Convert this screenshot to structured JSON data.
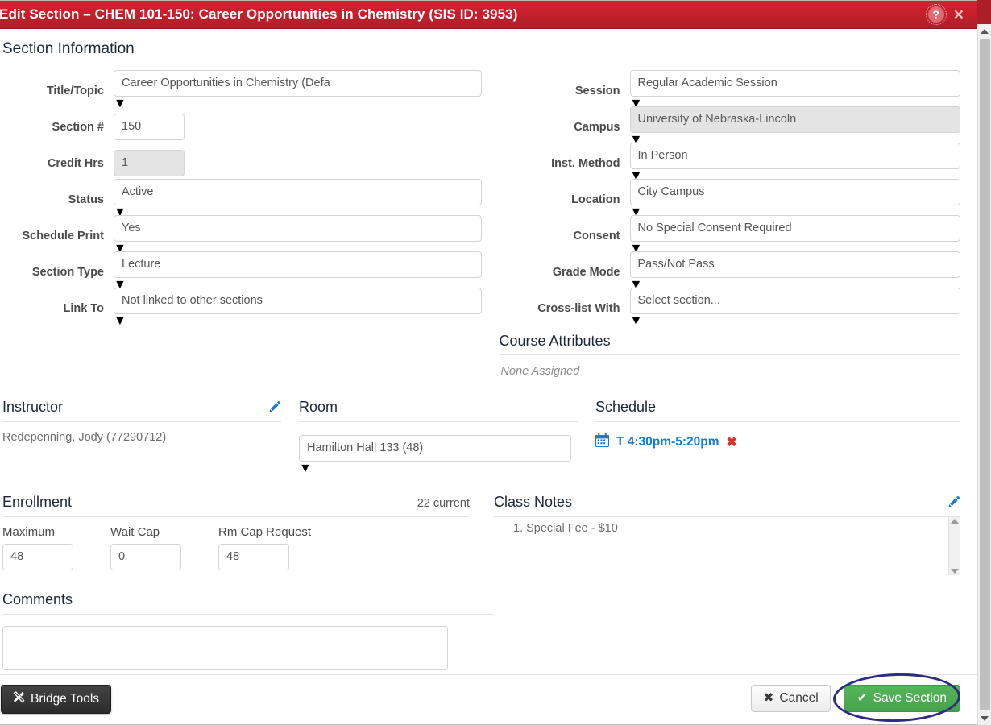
{
  "window": {
    "title": "Edit Section – CHEM 101-150: Career Opportunities in Chemistry (SIS ID: 3953)",
    "help_icon": "question-circle-icon",
    "close_icon": "×",
    "header_color": "#c9202c"
  },
  "section_information": {
    "heading": "Section Information",
    "left_fields": [
      {
        "label": "Title/Topic",
        "value": "Career Opportunities in Chemistry (Defa",
        "type": "select",
        "disabled": false
      },
      {
        "label": "Section #",
        "value": "150",
        "type": "text",
        "disabled": false
      },
      {
        "label": "Credit Hrs",
        "value": "1",
        "type": "text",
        "disabled": true
      },
      {
        "label": "Status",
        "value": "Active",
        "type": "select",
        "disabled": false
      },
      {
        "label": "Schedule Print",
        "value": "Yes",
        "type": "select",
        "disabled": false
      },
      {
        "label": "Section Type",
        "value": "Lecture",
        "type": "select",
        "disabled": false
      },
      {
        "label": "Link To",
        "value": "Not linked to other sections",
        "type": "select",
        "disabled": false
      }
    ],
    "right_fields": [
      {
        "label": "Session",
        "value": "Regular Academic Session",
        "type": "select",
        "disabled": false
      },
      {
        "label": "Campus",
        "value": "University of Nebraska-Lincoln",
        "type": "select",
        "disabled": true
      },
      {
        "label": "Inst. Method",
        "value": "In Person",
        "type": "select",
        "disabled": false
      },
      {
        "label": "Location",
        "value": "City Campus",
        "type": "select",
        "disabled": false
      },
      {
        "label": "Consent",
        "value": "No Special Consent Required",
        "type": "select",
        "disabled": false
      },
      {
        "label": "Grade Mode",
        "value": "Pass/Not Pass",
        "type": "select",
        "disabled": false
      },
      {
        "label": "Cross-list With",
        "value": "Select section...",
        "type": "select",
        "disabled": false
      }
    ]
  },
  "course_attributes": {
    "heading": "Course Attributes",
    "value": "None Assigned"
  },
  "instructor": {
    "heading": "Instructor",
    "edit_icon": "pencil-icon",
    "value": "Redepenning, Jody (77290712)"
  },
  "room": {
    "heading": "Room",
    "value": "Hamilton Hall 133 (48)"
  },
  "schedule": {
    "heading": "Schedule",
    "items": [
      {
        "icon": "calendar-icon",
        "label": "T 4:30pm-5:20pm",
        "remove_icon": "✖"
      }
    ]
  },
  "enrollment": {
    "heading": "Enrollment",
    "current": "22 current",
    "fields": [
      {
        "label": "Maximum",
        "value": "48"
      },
      {
        "label": "Wait Cap",
        "value": "0"
      },
      {
        "label": "Rm Cap Request",
        "value": "48"
      }
    ]
  },
  "class_notes": {
    "heading": "Class Notes",
    "edit_icon": "pencil-icon",
    "notes": [
      "1. Special Fee - $10"
    ]
  },
  "comments": {
    "heading": "Comments",
    "value": "",
    "placeholder": ""
  },
  "footer": {
    "bridge_tools_label": "Bridge Tools",
    "bridge_tools_icon": "tools-icon",
    "cancel_label": "Cancel",
    "cancel_icon": "✖",
    "save_label": "Save Section",
    "save_icon": "✔",
    "save_color": "#4aa34f"
  }
}
